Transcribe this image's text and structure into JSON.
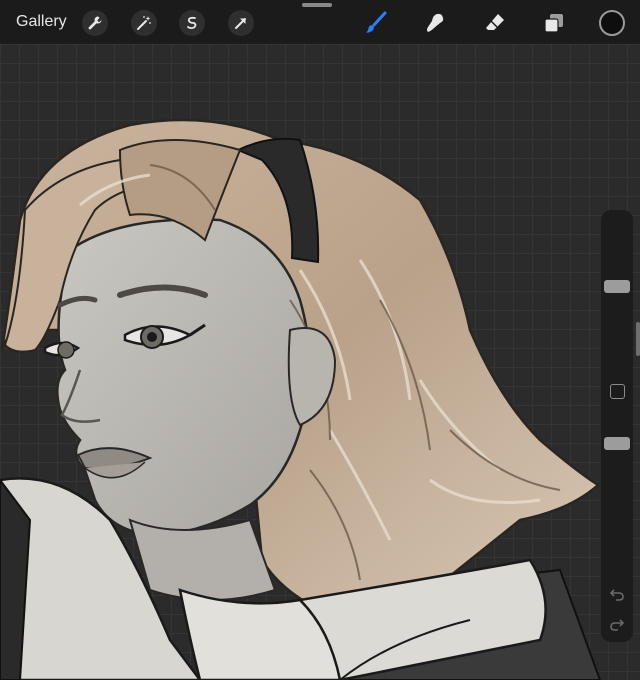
{
  "toolbar": {
    "gallery_label": "Gallery",
    "left_tools": [
      "wrench-icon",
      "magic-wand-icon",
      "selection-icon",
      "transform-arrow-icon"
    ],
    "right_tools": [
      "brush-icon",
      "smudge-icon",
      "eraser-icon",
      "layers-icon"
    ],
    "active_tool": "brush",
    "accent_color": "#2f7ef6",
    "current_color": "#0e0e0e"
  },
  "sidebar": {
    "brush_size_level": 0.55,
    "opacity_level": 0.15,
    "controls": [
      "brush-size-slider",
      "modify-button",
      "opacity-slider",
      "undo-button",
      "redo-button"
    ]
  }
}
